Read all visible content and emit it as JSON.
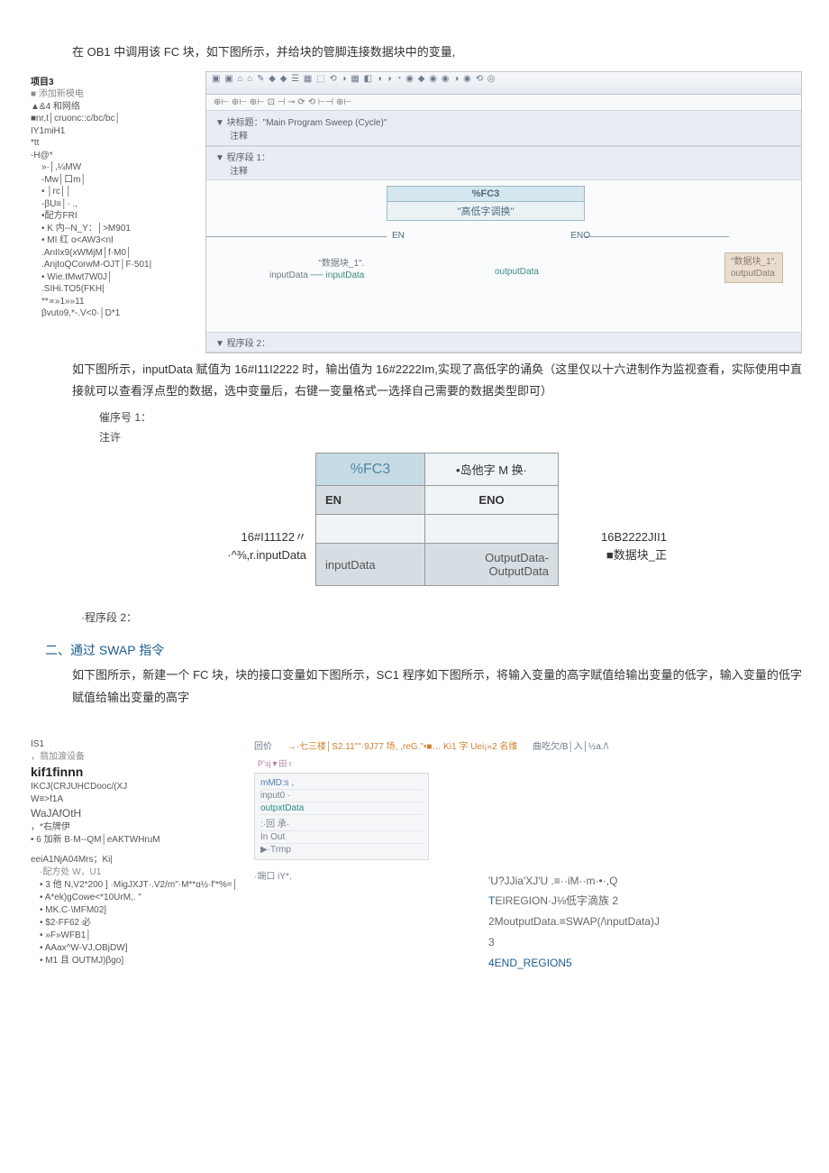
{
  "para1": "在 OB1 中调用该 FC 块，如下图所示，并给块的管脚连接数据块中的变量,",
  "tree1": {
    "t1": "项目3",
    "t2": "■ 添加新模电",
    "t3": "▲&4 和网络",
    "t4": "■nr,t│cruonc::c/bc/bc│",
    "t5": "IY1miH1",
    "t6": "*tt",
    "t7": "-H@*",
    "t8": "»·│,¼MW",
    "t9": "-Mw│口m│",
    "t10": "•            │rc││",
    "t11": "-βU≡│·             .,",
    "t12": "•配方FRI",
    "t13": "•  K 内--N_Y：│>M901",
    "t14": "•  MI 红 o<AW3<nI",
    "t15": ".AnIIx9(xWMjM│f·M0│",
    "t16": ".AnjtoQCorwM-OJT│F·501|",
    "t17": "•  Wie.tMwt7W0J│",
    "t18": ".SIHi.TO5(FKH|",
    "t19": "**∝»1»»11",
    "t20": "βvuto9,*-.V<0·│D*1"
  },
  "editor1": {
    "toolbar": "▣ ▣   ⌂ ⌂ ✎ ◆ ◆ ☰ ▦ ⬚ ⟲ ◑ ▦ ◧ ◑ ◑ ◔ ◉ ◆ ◉ ◉ ◑ ◉ ⟲ ◎",
    "navstrip": "⊕⊢ ⊕⊢ ⊕⊢ ⊡ ⊣ ⊸ ⟳ ⟲ ⊢⊣ ⊕⊢",
    "blocktitle": "▼ 块标题：\"Main Program Sweep (Cycle)\"",
    "comment": "注释",
    "seg1": "▼ 程序段 1：",
    "segcomment": "注释",
    "fcId": "%FC3",
    "fcName": "\"高低字调换\"",
    "en": "EN",
    "eno": "ENO",
    "leftWire1": "\"数据块_1\".",
    "leftWire2": "inputData",
    "pinIn": "inputData",
    "pinOut": "outputData",
    "rightWire1": "\"数据块_1\".",
    "rightWire2": "outputData",
    "seg2strip": "▼ 程序段 2："
  },
  "para2": "如下图所示，inputData 赋值为 16#I11I2222 时，输出值为 16#2222Im,实现了高低字的诵奂（这里仅以十六进制作为监视查看，实际使用中直接就可以查看浮点型的数据，选中变量后，右键一变量格式一选择自己需要的数据类型即可）",
  "midnote1": "催序号 1：",
  "midnote2": "注许",
  "fc3": {
    "id": "%FC3",
    "name": "•岛他字 M 换·",
    "en": "EN",
    "eno": "ENO",
    "leftval": "16#I11122〃",
    "leftlab": "·^⅜,r.inputData",
    "rightval": "16B2222JII1",
    "rightlab": "■数据块_正",
    "pinIn": "inputData",
    "pinOut": "OutputData-OutputData"
  },
  "seg2txt": "·程序段 2：",
  "h2": "二、通过 SWAP 指令",
  "para3": "如下图所示，新建一个 FC 块，块的接口变量如下图所示，SC1 程序如下图所示，将输入变量的高字赋值给输出变量的低字，输入变量的低字赋值给输出变量的高字",
  "tree2": {
    "l1": "IS1",
    "l2": "，翡加渡设备",
    "l3": "kif1finnn",
    "l4": "IKCJ(CRJUHCDooc/(XJ",
    "l5": "W≡>f1A",
    "l6": "WaJAfOtH",
    "l7": "，*右牌伊",
    "l8": "•  6 加新 B·M--QM│eAKTWHruM",
    "l9": "eeiA1NjA04Mrs；Ki|",
    "l10": "·配方处 W，U1",
    "l11": "•  3 他 N,V2*200 ] ·MigJXJT·.V2/m\"·M**ɑ½·f'*%=│",
    "l12": "•  A*ek)gCowe<*10UrM,. \"",
    "l13": "•  MK.C·\\MFM02]",
    "l14": "•  $2-FF62 必",
    "l15": "•  »F»WFB1│",
    "l16": "•  AAax^W-VJ,OBjDW]",
    "l17": "•  M1 且 OUTMJ)βgo]"
  },
  "shot2head": {
    "a": "回价",
    "b": "→·七三楼│S2.11\"\"·9J77 场,  ,reG.\"•■… Ki1 字 Uei¡»2 名维",
    "c": "曲吃欠/B│入│½a./\\",
    "d": "Pʼsj▼田 r"
  },
  "editrows": {
    "r1": "mMD:s ,",
    "r2": "input0 ·",
    "r3": "outpxtData",
    "r4": ":·回 承·",
    "r5": "In Out",
    "r6": "▶·Trmp"
  },
  "smallblock": {
    "s1": "·端口 iY*,"
  },
  "code": {
    "l1q": "'U?JJia'XJ'U .≡··iM··m·•·,Q",
    "l1": "EIREGION·J⅛低字滴族 2",
    "l2": "2MoutputData.≡SWAP(/\\nputData)J",
    "l3": "3",
    "l4": "4END_REGION5"
  }
}
